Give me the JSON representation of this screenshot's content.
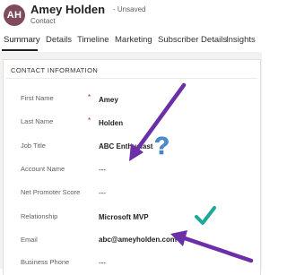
{
  "record": {
    "initials": "AH",
    "name": "Amey Holden",
    "status": "- Unsaved",
    "entity": "Contact"
  },
  "tabs": [
    {
      "label": "Summary",
      "active": true
    },
    {
      "label": "Details"
    },
    {
      "label": "Timeline"
    },
    {
      "label": "Marketing"
    },
    {
      "label": "Subscriber Details"
    },
    {
      "label": "Insights"
    }
  ],
  "section": {
    "title": "CONTACT INFORMATION",
    "fields": [
      {
        "label": "First Name",
        "required": "*",
        "value": "Amey"
      },
      {
        "label": "Last Name",
        "required": "*",
        "value": "Holden"
      },
      {
        "label": "Job Title",
        "value": "ABC Enthusiast"
      },
      {
        "label": "Account Name",
        "value": "---"
      },
      {
        "label": "Net Promoter Score",
        "value": "---"
      },
      {
        "label": "Relationship",
        "value": "Microsoft MVP"
      },
      {
        "label": "Email",
        "value": "abc@ameyholden.com"
      },
      {
        "label": "Business Phone",
        "value": "---"
      }
    ]
  },
  "annotations": {
    "question_mark": "?",
    "arrow_color": "#6b2fa8",
    "question_color": "#4a8fd4",
    "check_color": "#1ea896"
  },
  "colors": {
    "avatar_bg": "#7f4b5b",
    "required": "#a4262c"
  }
}
